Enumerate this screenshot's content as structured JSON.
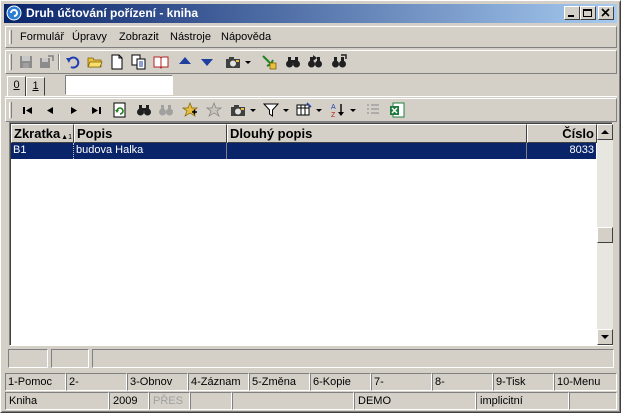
{
  "window": {
    "title": "Druh účtování pořízení - kniha"
  },
  "menu": {
    "items": [
      "Formulář",
      "Úpravy",
      "Zobrazit",
      "Nástroje",
      "Nápověda"
    ]
  },
  "tabs": [
    "0",
    "1"
  ],
  "grid": {
    "columns": [
      {
        "label": "Zkratka",
        "sort_indicator": "▲1"
      },
      {
        "label": "Popis"
      },
      {
        "label": "Dlouhý popis"
      },
      {
        "label": "Číslo"
      }
    ],
    "rows": [
      {
        "zkratka": "B1",
        "popis": "budova Halka",
        "dlouhy_popis": "",
        "cislo": "8033"
      }
    ]
  },
  "fkeys": [
    "1-Pomoc",
    "2-",
    "3-Obnov",
    "4-Záznam",
    "5-Změna",
    "6-Kopie",
    "7-",
    "8-",
    "9-Tisk",
    "10-Menu"
  ],
  "status": {
    "mode": "Kniha",
    "year": "2009",
    "insert": "PŘES",
    "db": "DEMO",
    "profile": "implicitní"
  },
  "colors": {
    "titlebar": "#0a246a",
    "selection": "#0a246a",
    "face": "#d4d0c8"
  }
}
